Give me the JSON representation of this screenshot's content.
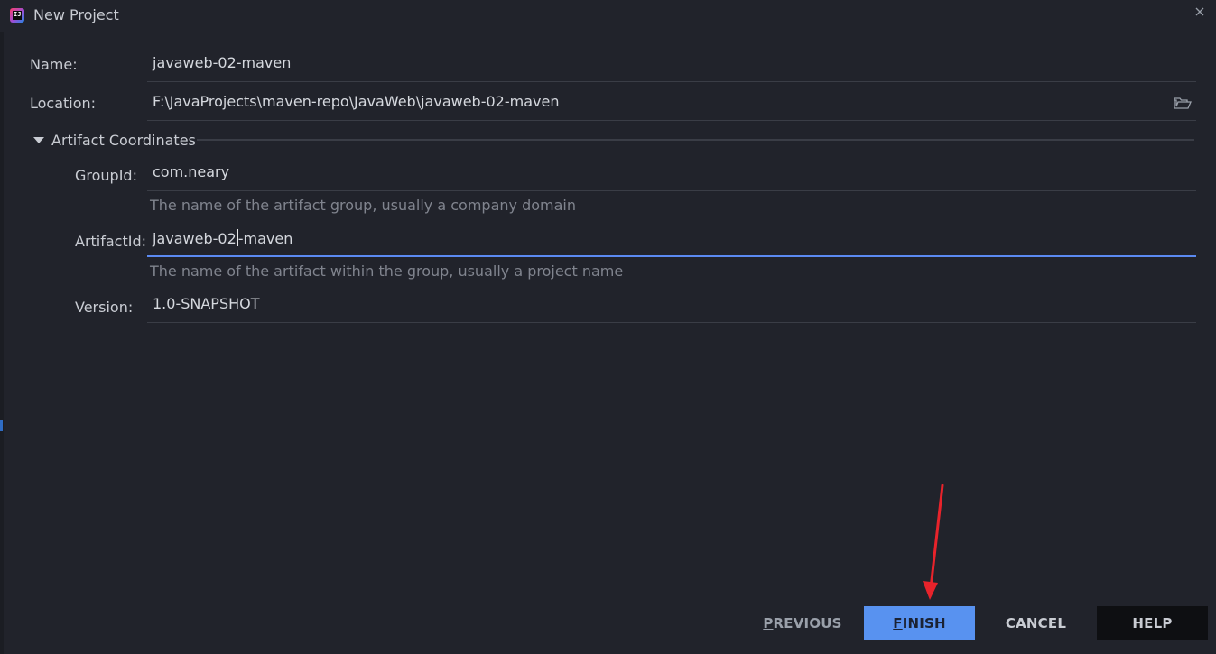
{
  "window": {
    "title": "New Project",
    "app_icon": "intellij-idea-icon",
    "close_icon": "close-icon"
  },
  "form": {
    "name": {
      "label": "Name:",
      "value": "javaweb-02-maven"
    },
    "location": {
      "label": "Location:",
      "value": "F:\\JavaProjects\\maven-repo\\JavaWeb\\javaweb-02-maven",
      "browse_icon": "folder-icon"
    },
    "artifact_section": {
      "label": "Artifact Coordinates",
      "expanded": true,
      "group_id": {
        "label": "GroupId:",
        "value": "com.neary",
        "hint": "The name of the artifact group, usually a company domain"
      },
      "artifact_id": {
        "label": "ArtifactId:",
        "value_before_caret": "javaweb-02",
        "value_after_caret": "-maven",
        "hint": "The name of the artifact within the group, usually a project name",
        "focused": true
      },
      "version": {
        "label": "Version:",
        "value": "1.0-SNAPSHOT"
      }
    }
  },
  "buttons": {
    "previous": {
      "mnemonic": "P",
      "rest": "REVIOUS"
    },
    "finish": {
      "mnemonic": "F",
      "rest": "INISH"
    },
    "cancel": "CANCEL",
    "help": "HELP"
  },
  "colors": {
    "background": "#21232b",
    "accent": "#5892f0",
    "focus_underline": "#5b8af2",
    "annotation_arrow": "#e8232b"
  }
}
